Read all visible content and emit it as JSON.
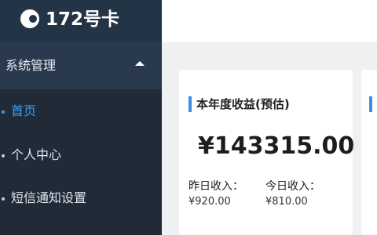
{
  "brand": {
    "name": "172号卡"
  },
  "sidebar": {
    "group_label": "系统管理",
    "items": [
      {
        "label": "首页",
        "active": true
      },
      {
        "label": "个人中心",
        "active": false
      },
      {
        "label": "短信通知设置",
        "active": false
      }
    ]
  },
  "card": {
    "title": "本年度收益(预估)",
    "amount": "¥143315.00",
    "yesterday_label": "昨日收入：",
    "yesterday_value": "¥920.00",
    "today_label": "今日收入：",
    "today_value": "¥810.00"
  },
  "colors": {
    "sidebar_bg": "#212b38",
    "accent": "#3d9cf0"
  }
}
